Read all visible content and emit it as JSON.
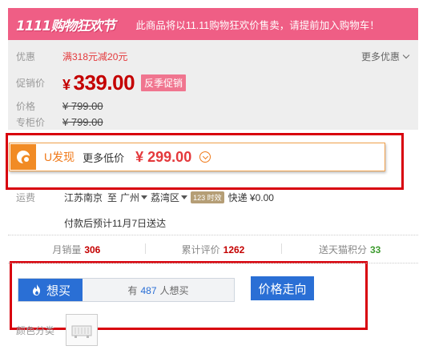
{
  "banner": {
    "logo_text": "1111购物狂欢节",
    "message": "此商品将以11.11购物狂欢价售卖，请提前加入购物车！"
  },
  "promo": {
    "label": "优惠",
    "value": "满318元减20元",
    "more_label": "更多优惠"
  },
  "sale_price": {
    "label": "促销价",
    "currency": "¥",
    "amount": "339.00",
    "badge": "反季促销"
  },
  "list_price": {
    "label": "价格",
    "value": "¥ 799.00"
  },
  "counter_price": {
    "label": "专柜价",
    "value": "¥ 799.00"
  },
  "u_discover": {
    "name": "U发现",
    "more_text": "更多低价",
    "price": "¥ 299.00"
  },
  "shipping": {
    "label": "运费",
    "from": "江苏南京",
    "to_word": "至",
    "city": "广州",
    "district": "荔湾区",
    "time_badge": "123 时效",
    "fee": "快递 ¥0.00",
    "delivery": "付款后预计11月7日送达"
  },
  "stats": {
    "monthly_sales_label": "月销量",
    "monthly_sales": "306",
    "reviews_label": "累计评价",
    "reviews": "1262",
    "points_label": "送天猫积分",
    "points": "33"
  },
  "want": {
    "button_label": "想买",
    "count_prefix": "有",
    "count": "487",
    "count_suffix": "人想买"
  },
  "trend_button": "价格走向",
  "color": {
    "label": "颜色分类"
  },
  "colors": {
    "banner_bg": "#ef5e85",
    "price_red": "#c40000",
    "accent_orange": "#f07a1a",
    "button_blue": "#2a6fd5",
    "highlight_red": "#d8000d"
  }
}
